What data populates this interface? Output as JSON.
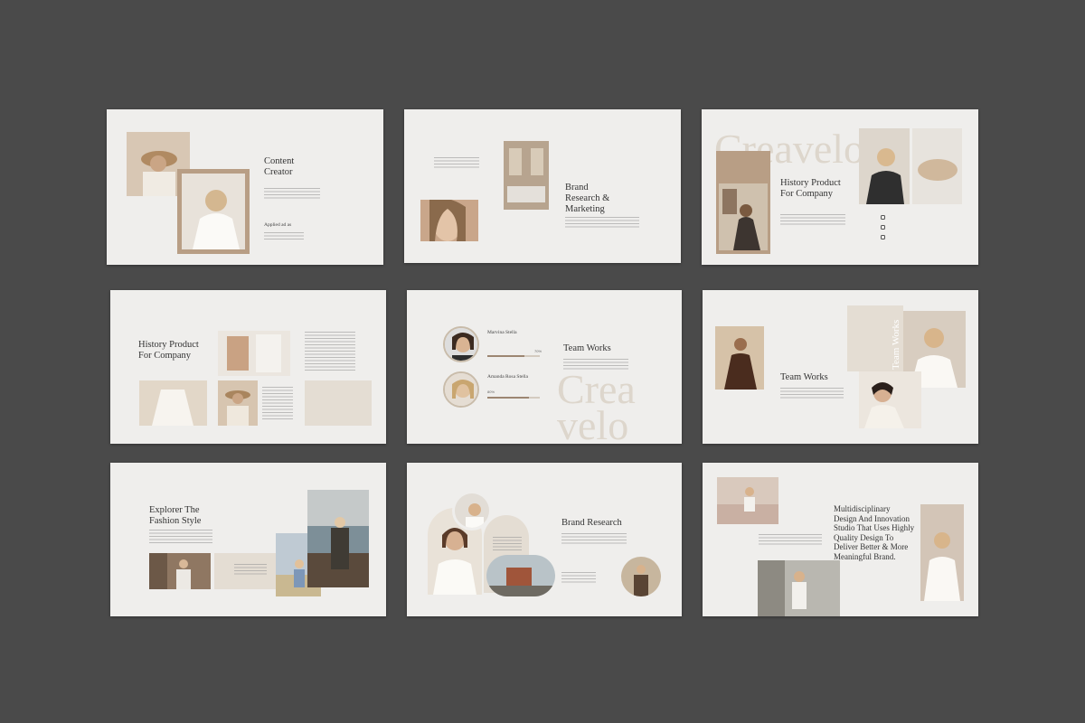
{
  "slides": [
    {
      "title": "Content\nCreator",
      "subtitle": "Applied ad as"
    },
    {
      "title": "Brand\nResearch &\nMarketing"
    },
    {
      "title": "History Product\nFor Company",
      "watermark": "Creavelo"
    },
    {
      "title": "History Product\nFor Company"
    },
    {
      "title": "Team Works",
      "watermark": "Crea\nvelo",
      "members": [
        {
          "name": "Marvina Stella",
          "percent": "70%"
        },
        {
          "name": "Amanda Rosa Stella",
          "percent": "80%"
        }
      ]
    },
    {
      "title": "Team Works",
      "vertical": "Team Works"
    },
    {
      "title": "Explorer The\nFashion Style"
    },
    {
      "title": "Brand Research"
    },
    {
      "title": "Multidisciplinary\nDesign And Innovation\nStudio That Uses Highly\nQuality Design To\nDeliver Better & More\nMeaningful Brand."
    }
  ]
}
